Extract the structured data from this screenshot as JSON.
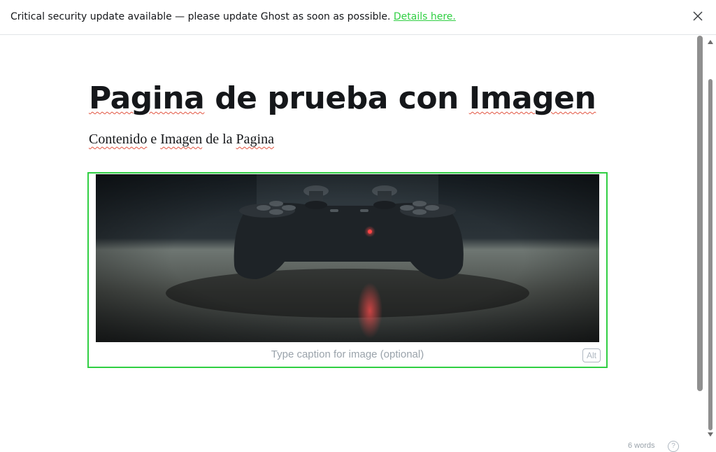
{
  "banner": {
    "message": "Critical security update available — please update Ghost as soon as possible.",
    "link_label": "Details here."
  },
  "post": {
    "title_words": [
      "Pagina",
      "de",
      "prueba",
      "con",
      "Imagen"
    ],
    "paragraph_words": [
      "Contenido",
      "e",
      "Imagen",
      "de",
      "la",
      "Pagina"
    ]
  },
  "image_card": {
    "caption_placeholder": "Type caption for image (optional)",
    "alt_label": "Alt"
  },
  "status": {
    "word_count": "6 words",
    "help_label": "?"
  },
  "colors": {
    "accent": "#30cf43",
    "spellcheck": "#e25440"
  }
}
